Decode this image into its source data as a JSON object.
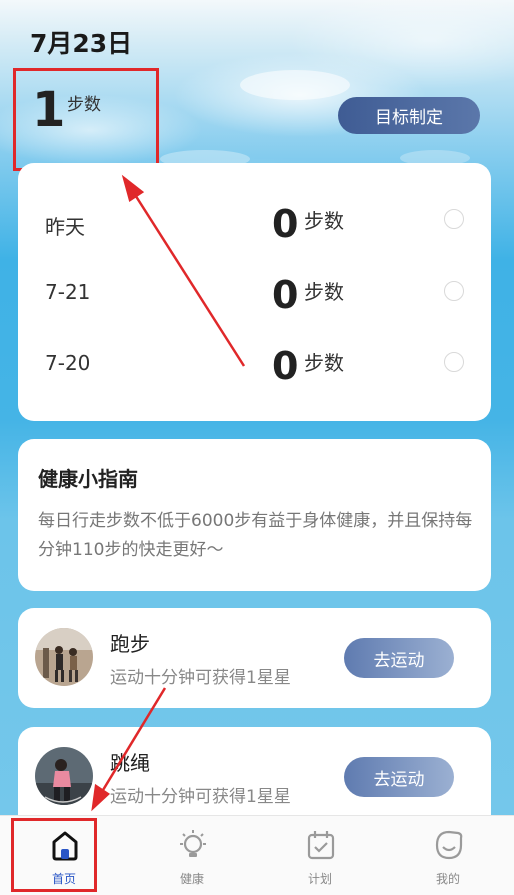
{
  "header": {
    "date": "7月23日",
    "today_steps": "1",
    "today_unit": "步数",
    "goal_button": "目标制定"
  },
  "history": [
    {
      "label": "昨天",
      "value": "0",
      "unit": "步数"
    },
    {
      "label": "7-21",
      "value": "0",
      "unit": "步数"
    },
    {
      "label": "7-20",
      "value": "0",
      "unit": "步数"
    }
  ],
  "guide": {
    "title": "健康小指南",
    "text": "每日行走步数不低于6000步有益于身体健康，并且保持每分钟110步的快走更好～"
  },
  "activities": [
    {
      "title": "跑步",
      "subtitle": "运动十分钟可获得1星星",
      "button": "去运动"
    },
    {
      "title": "跳绳",
      "subtitle": "运动十分钟可获得1星星",
      "button": "去运动"
    }
  ],
  "tabs": [
    {
      "label": "首页",
      "icon": "home-icon",
      "active": true
    },
    {
      "label": "健康",
      "icon": "lightbulb-icon",
      "active": false
    },
    {
      "label": "计划",
      "icon": "calendar-check-icon",
      "active": false
    },
    {
      "label": "我的",
      "icon": "smile-face-icon",
      "active": false
    }
  ],
  "colors": {
    "annotation_red": "#e0282a",
    "accent_blue": "#2a56c6",
    "goal_button": "#4a6aa0"
  }
}
